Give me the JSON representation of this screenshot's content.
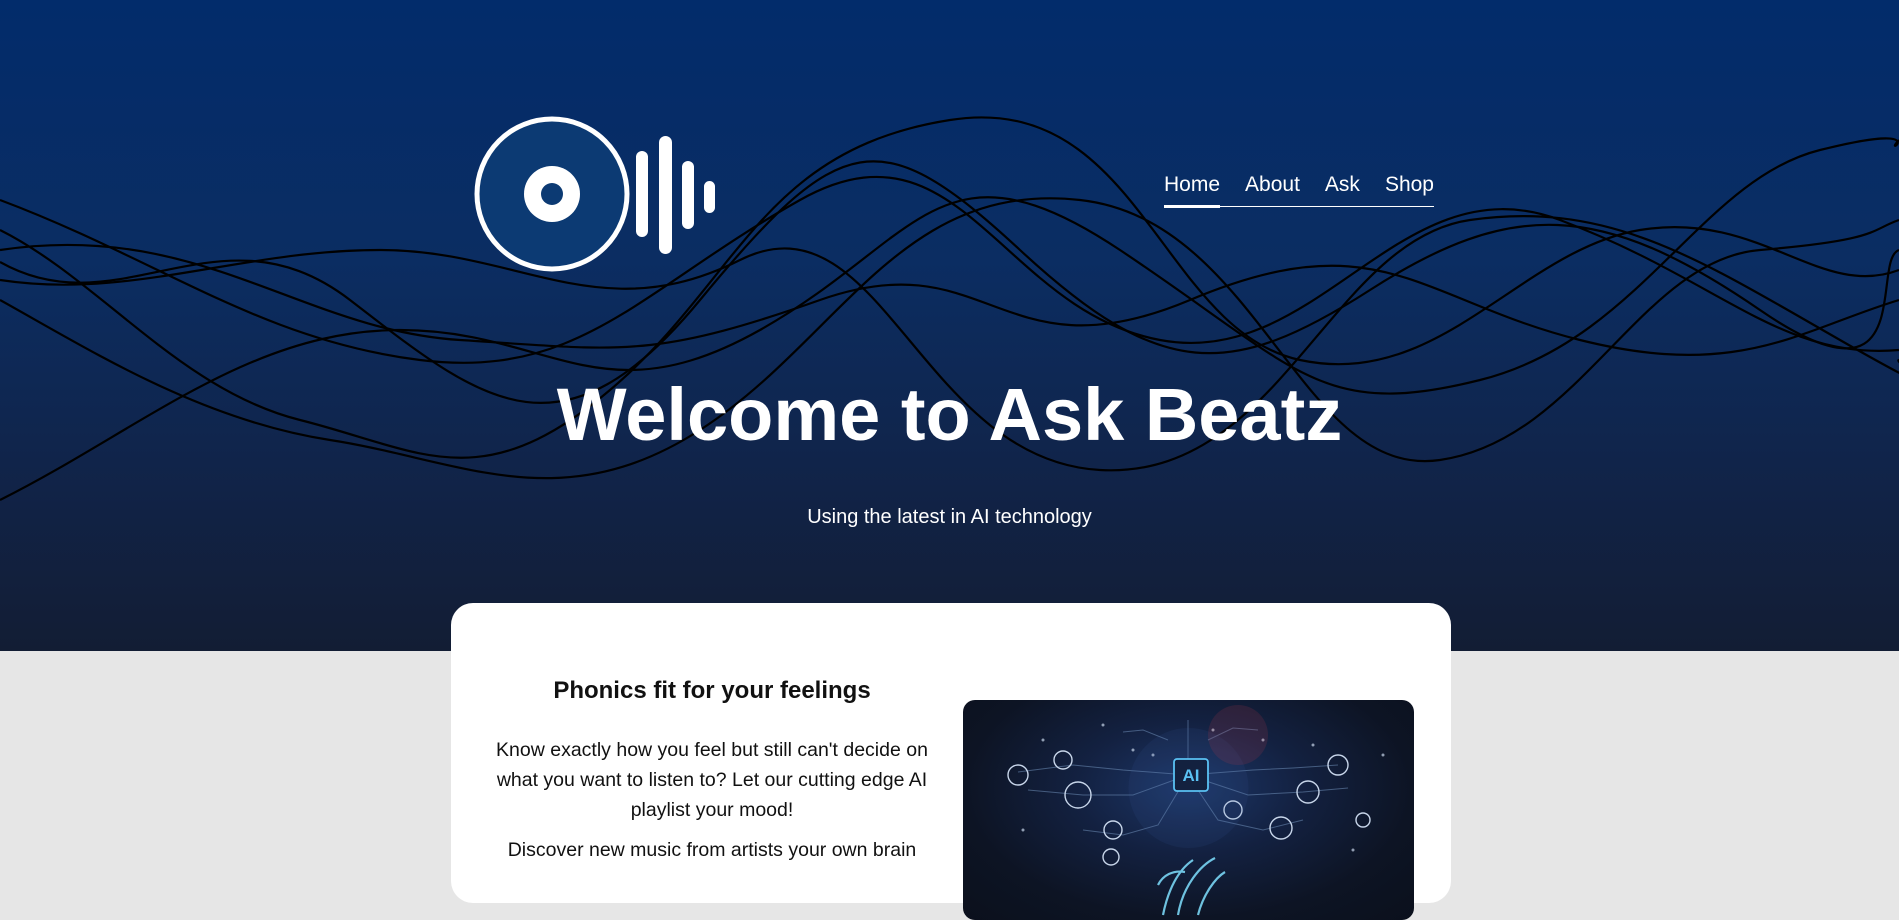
{
  "site": {
    "logo_icon": "vinyl-soundwave-logo-icon"
  },
  "nav": {
    "items": [
      {
        "label": "Home",
        "active": true
      },
      {
        "label": "About",
        "active": false
      },
      {
        "label": "Ask",
        "active": false
      },
      {
        "label": "Shop",
        "active": false
      }
    ]
  },
  "hero": {
    "title": "Welcome to Ask Beatz",
    "subtitle": "Using the latest in AI technology"
  },
  "feature": {
    "heading": "Phonics fit for your feelings",
    "paragraph1": "Know exactly how you feel but still can't decide on what you want to listen to? Let our cutting edge AI playlist your mood!",
    "paragraph2": "Discover new music from artists your own brain",
    "image_label": "AI"
  },
  "colors": {
    "hero_top": "#022c6b",
    "hero_bottom": "#121d34",
    "page_background": "#e6e6e6",
    "card_background": "#ffffff",
    "logo_disc": "#0c3a73",
    "ai_accent": "#5fd0ff"
  }
}
